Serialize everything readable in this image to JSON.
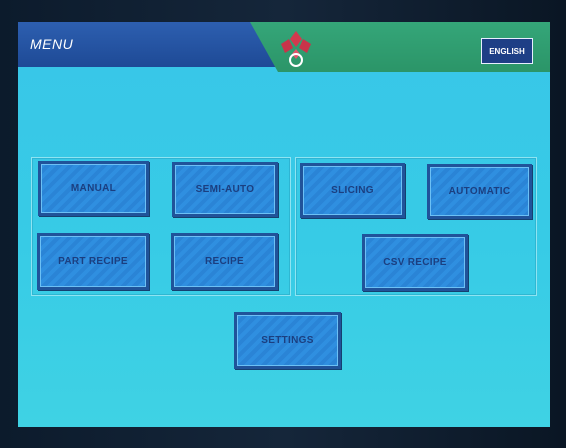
{
  "header": {
    "title": "MENU",
    "logo_icon": "diamond-logo-icon",
    "language_button": "ENGLISH"
  },
  "colors": {
    "screen_background": "#38c6e8",
    "header_blue": "#1e4a96",
    "header_green": "#2b9568",
    "button_fill": "#2f8fe0",
    "button_border": "#20539a",
    "button_text": "#1b3f80",
    "logo_red": "#d23a4e"
  },
  "menu": {
    "manual": "MANUAL",
    "semi_auto": "SEMI-AUTO",
    "slicing": "SLICING",
    "automatic": "AUTOMATIC",
    "part_recipe": "PART RECIPE",
    "recipe": "RECIPE",
    "csv_recipe": "CSV RECIPE",
    "settings": "SETTINGS"
  }
}
